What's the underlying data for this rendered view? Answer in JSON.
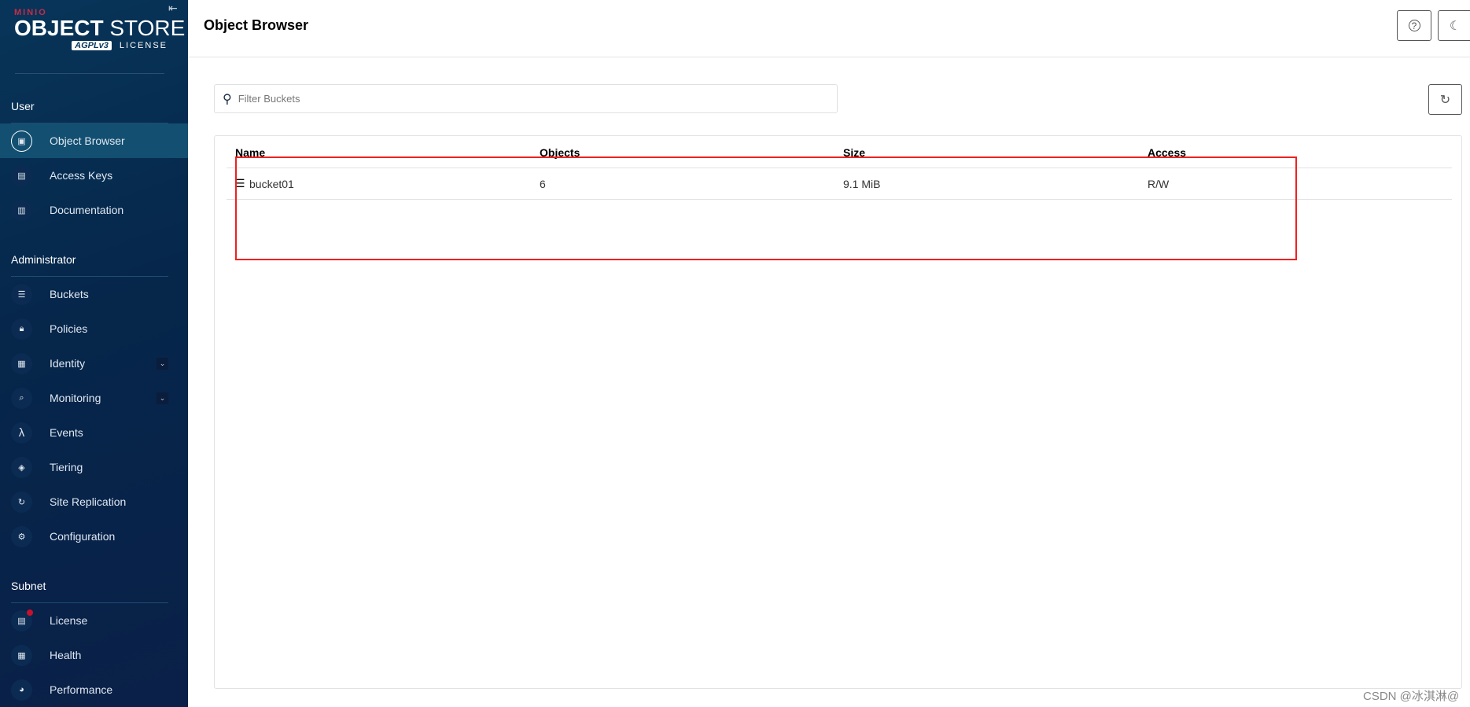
{
  "sidebar": {
    "logo": {
      "brand": "MINIO",
      "product_bold": "OBJECT",
      "product_light": "STORE",
      "license_badge": "AGPLv3",
      "license": "LICENSE"
    },
    "sections": [
      {
        "title": "User",
        "items": [
          {
            "label": "Object Browser",
            "icon": "object-browser-icon",
            "active": true
          },
          {
            "label": "Access Keys",
            "icon": "access-keys-icon"
          },
          {
            "label": "Documentation",
            "icon": "documentation-icon"
          }
        ]
      },
      {
        "title": "Administrator",
        "items": [
          {
            "label": "Buckets",
            "icon": "bucket-icon"
          },
          {
            "label": "Policies",
            "icon": "lock-icon"
          },
          {
            "label": "Identity",
            "icon": "identity-icon",
            "expandable": true
          },
          {
            "label": "Monitoring",
            "icon": "monitoring-icon",
            "expandable": true
          },
          {
            "label": "Events",
            "icon": "lambda-icon"
          },
          {
            "label": "Tiering",
            "icon": "layers-icon"
          },
          {
            "label": "Site Replication",
            "icon": "replication-icon"
          },
          {
            "label": "Configuration",
            "icon": "gear-icon"
          }
        ]
      },
      {
        "title": "Subnet",
        "items": [
          {
            "label": "License",
            "icon": "license-icon",
            "badge": true
          },
          {
            "label": "Health",
            "icon": "health-icon"
          },
          {
            "label": "Performance",
            "icon": "performance-icon"
          }
        ]
      }
    ]
  },
  "header": {
    "title": "Object Browser"
  },
  "search": {
    "placeholder": "Filter Buckets",
    "value": ""
  },
  "table": {
    "columns": [
      "Name",
      "Objects",
      "Size",
      "Access"
    ],
    "rows": [
      {
        "name": "bucket01",
        "objects": "6",
        "size": "9.1 MiB",
        "access": "R/W"
      }
    ]
  },
  "annotation": {
    "color": "#f02020"
  },
  "watermark": "CSDN @冰淇淋@",
  "colors": {
    "sidebar": "#06264a",
    "active_item": "#134f71",
    "badge": "#c8102e"
  }
}
